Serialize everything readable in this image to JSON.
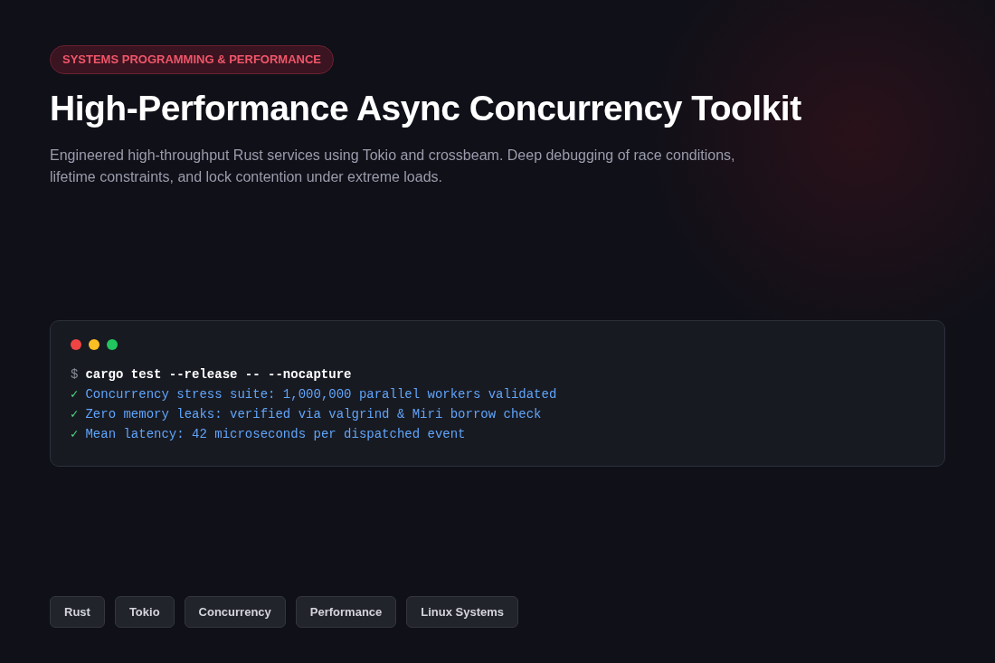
{
  "badge": "SYSTEMS PROGRAMMING & PERFORMANCE",
  "title": "High-Performance Async Concurrency Toolkit",
  "description": "Engineered high-throughput Rust services using Tokio and crossbeam. Deep debugging of race conditions, lifetime constraints, and lock contention under extreme loads.",
  "terminal": {
    "dots": [
      {
        "color": "#ef4444"
      },
      {
        "color": "#fbbf24"
      },
      {
        "color": "#22c55e"
      }
    ],
    "lines": [
      {
        "kind": "command",
        "prompt": "$",
        "text": "cargo test --release -- --nocapture"
      },
      {
        "kind": "result",
        "prompt": "✓",
        "text": "Concurrency stress suite: 1,000,000 parallel workers validated"
      },
      {
        "kind": "result",
        "prompt": "✓",
        "text": "Zero memory leaks: verified via valgrind & Miri borrow check"
      },
      {
        "kind": "result",
        "prompt": "✓",
        "text": "Mean latency: 42 microseconds per dispatched event"
      }
    ]
  },
  "tags": [
    "Rust",
    "Tokio",
    "Concurrency",
    "Performance",
    "Linux Systems"
  ]
}
